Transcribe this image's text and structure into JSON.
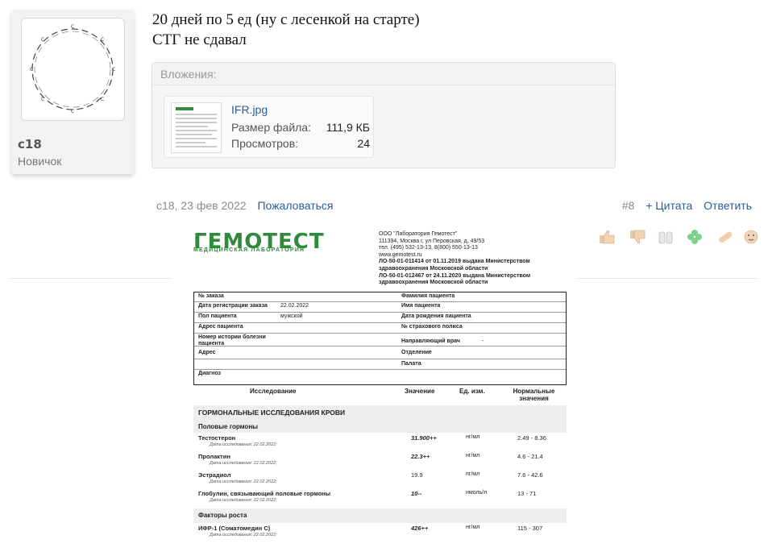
{
  "user": {
    "name": "с18",
    "title": "Новичок",
    "avatar_icon": "carbon-ring-icon"
  },
  "message": {
    "line1": "20 дней по 5 ед (ну с лесенкой на старте)",
    "line2": "СТГ не сдавал"
  },
  "attachments": {
    "header": "Вложения:",
    "file": {
      "name": "IFR.jpg",
      "size_label": "Размер файла:",
      "size": "111,9 КБ",
      "views_label": "Просмотров:",
      "views": "24"
    }
  },
  "post_meta": {
    "author_date": "с18, 23 фев 2022",
    "report": "Пожаловаться",
    "number": "#8",
    "quote": "+ Цитата",
    "reply": "Ответить"
  },
  "reactions": [
    "thumbs-up-icon",
    "thumbs-down-icon",
    "cheers-icon",
    "clover-icon",
    "bandage-icon",
    "face-icon"
  ],
  "doc": {
    "logo_main": "ГЕМОТЕСТ",
    "logo_sub": "МЕДИЦИНСКАЯ ЛАБОРАТОРИЯ",
    "lab_info": [
      "ООО \"Лаборатория Гемотест\"",
      "111394, Москва г, ул Перовская, д. 49/53",
      "тел. (495) 532-13-13, 8(800) 550-13-13",
      "www.gemotest.ru",
      "ЛО-50-01-011414 от 01.11.2019 выдана Министерством",
      "здравоохранения Московской области",
      "ЛО-50-01-012467 от 24.11.2020 выдана Министерством",
      "здравоохранения Московской области"
    ],
    "fields_left": [
      "№ заказа",
      "Дата регистрации заказа",
      "Пол пациента",
      "Адрес пациента",
      "Номер истории болезни пациента",
      "Адрес",
      "",
      "Диагноз"
    ],
    "reg_date": "22.02.2022",
    "sex": "мужской",
    "fields_right": [
      "Фамилия пациента",
      "Имя пациента",
      "Дата рождения пациента",
      "№ страхового полиса",
      "Направляющий врач",
      "Отделение",
      "Палата"
    ],
    "doctor": "-",
    "col_headers": [
      "Исследование",
      "Значение",
      "Ед. изм.",
      "Нормальные значения"
    ],
    "section": "ГОРМОНАЛЬНЫЕ ИССЛЕДОВАНИЯ КРОВИ",
    "group1": "Половые гормоны",
    "rows1": [
      {
        "name": "Тестостерон",
        "date": "Дата исследования: 22.02.2022;",
        "value": "31.900++",
        "unit": "нг/мл",
        "norm": "2.49 - 8.36"
      },
      {
        "name": "Пролактин",
        "date": "Дата исследования: 22.02.2022;",
        "value": "22.3++",
        "unit": "нг/мл",
        "norm": "4.6 - 21.4"
      },
      {
        "name": "Эстрадиол",
        "date": "Дата исследования: 22.02.2022;",
        "value": "19.9",
        "unit": "пг/мл",
        "norm": "7.6 - 42.6"
      },
      {
        "name": "Глобулин, связывающий половые гормоны",
        "date": "Дата исследования: 22.02.2022;",
        "value": "10--",
        "unit": "нмоль/л",
        "norm": "13 - 71"
      }
    ],
    "group2": "Факторы роста",
    "rows2": [
      {
        "name": "ИФР-1 (Соматомедин С)",
        "date": "Дата исследования: 22.02.2022;",
        "value": "426++",
        "unit": "нг/мл",
        "norm": "115 - 307"
      }
    ]
  }
}
